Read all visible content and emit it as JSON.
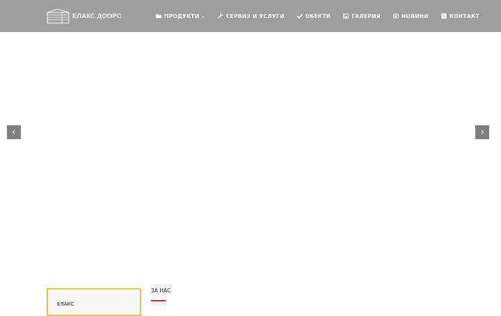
{
  "header": {
    "logo_text": "ЕЛАКС ДООРС",
    "logo_icon": "garage-door-icon"
  },
  "nav": {
    "items": [
      {
        "label": "ПРОДУКТИ",
        "icon": "folder-icon",
        "has_dropdown": true
      },
      {
        "label": "СЕРВИЗ И УСЛУГИ",
        "icon": "wrench-icon"
      },
      {
        "label": "ОБЕКТИ",
        "icon": "check-icon"
      },
      {
        "label": "ГАЛЕРИЯ",
        "icon": "image-icon"
      },
      {
        "label": "НОВИНИ",
        "icon": "newspaper-icon"
      },
      {
        "label": "КОНТАКТ",
        "icon": "phone-square-icon"
      }
    ],
    "dropdown_caret": "⌄"
  },
  "slider": {
    "prev_icon": "chevron-left-icon",
    "next_icon": "chevron-right-icon"
  },
  "side_box": {
    "label": "ЕЛАКС"
  },
  "about": {
    "title": "ЗА НАС"
  },
  "colors": {
    "header_bg": "#9e9e9e",
    "arrow_bg": "#808080",
    "box_border": "#e8c347",
    "underline": "#d32f2f"
  }
}
